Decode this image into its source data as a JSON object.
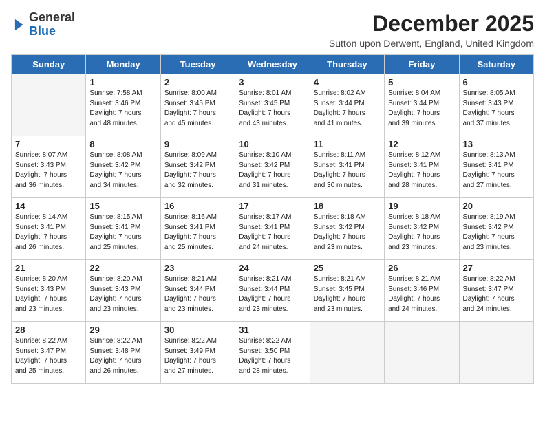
{
  "logo": {
    "general": "General",
    "blue": "Blue"
  },
  "title": "December 2025",
  "subtitle": "Sutton upon Derwent, England, United Kingdom",
  "days_header": [
    "Sunday",
    "Monday",
    "Tuesday",
    "Wednesday",
    "Thursday",
    "Friday",
    "Saturday"
  ],
  "weeks": [
    [
      {
        "day": "",
        "info": ""
      },
      {
        "day": "1",
        "info": "Sunrise: 7:58 AM\nSunset: 3:46 PM\nDaylight: 7 hours\nand 48 minutes."
      },
      {
        "day": "2",
        "info": "Sunrise: 8:00 AM\nSunset: 3:45 PM\nDaylight: 7 hours\nand 45 minutes."
      },
      {
        "day": "3",
        "info": "Sunrise: 8:01 AM\nSunset: 3:45 PM\nDaylight: 7 hours\nand 43 minutes."
      },
      {
        "day": "4",
        "info": "Sunrise: 8:02 AM\nSunset: 3:44 PM\nDaylight: 7 hours\nand 41 minutes."
      },
      {
        "day": "5",
        "info": "Sunrise: 8:04 AM\nSunset: 3:44 PM\nDaylight: 7 hours\nand 39 minutes."
      },
      {
        "day": "6",
        "info": "Sunrise: 8:05 AM\nSunset: 3:43 PM\nDaylight: 7 hours\nand 37 minutes."
      }
    ],
    [
      {
        "day": "7",
        "info": "Sunrise: 8:07 AM\nSunset: 3:43 PM\nDaylight: 7 hours\nand 36 minutes."
      },
      {
        "day": "8",
        "info": "Sunrise: 8:08 AM\nSunset: 3:42 PM\nDaylight: 7 hours\nand 34 minutes."
      },
      {
        "day": "9",
        "info": "Sunrise: 8:09 AM\nSunset: 3:42 PM\nDaylight: 7 hours\nand 32 minutes."
      },
      {
        "day": "10",
        "info": "Sunrise: 8:10 AM\nSunset: 3:42 PM\nDaylight: 7 hours\nand 31 minutes."
      },
      {
        "day": "11",
        "info": "Sunrise: 8:11 AM\nSunset: 3:41 PM\nDaylight: 7 hours\nand 30 minutes."
      },
      {
        "day": "12",
        "info": "Sunrise: 8:12 AM\nSunset: 3:41 PM\nDaylight: 7 hours\nand 28 minutes."
      },
      {
        "day": "13",
        "info": "Sunrise: 8:13 AM\nSunset: 3:41 PM\nDaylight: 7 hours\nand 27 minutes."
      }
    ],
    [
      {
        "day": "14",
        "info": "Sunrise: 8:14 AM\nSunset: 3:41 PM\nDaylight: 7 hours\nand 26 minutes."
      },
      {
        "day": "15",
        "info": "Sunrise: 8:15 AM\nSunset: 3:41 PM\nDaylight: 7 hours\nand 25 minutes."
      },
      {
        "day": "16",
        "info": "Sunrise: 8:16 AM\nSunset: 3:41 PM\nDaylight: 7 hours\nand 25 minutes."
      },
      {
        "day": "17",
        "info": "Sunrise: 8:17 AM\nSunset: 3:41 PM\nDaylight: 7 hours\nand 24 minutes."
      },
      {
        "day": "18",
        "info": "Sunrise: 8:18 AM\nSunset: 3:42 PM\nDaylight: 7 hours\nand 23 minutes."
      },
      {
        "day": "19",
        "info": "Sunrise: 8:18 AM\nSunset: 3:42 PM\nDaylight: 7 hours\nand 23 minutes."
      },
      {
        "day": "20",
        "info": "Sunrise: 8:19 AM\nSunset: 3:42 PM\nDaylight: 7 hours\nand 23 minutes."
      }
    ],
    [
      {
        "day": "21",
        "info": "Sunrise: 8:20 AM\nSunset: 3:43 PM\nDaylight: 7 hours\nand 23 minutes."
      },
      {
        "day": "22",
        "info": "Sunrise: 8:20 AM\nSunset: 3:43 PM\nDaylight: 7 hours\nand 23 minutes."
      },
      {
        "day": "23",
        "info": "Sunrise: 8:21 AM\nSunset: 3:44 PM\nDaylight: 7 hours\nand 23 minutes."
      },
      {
        "day": "24",
        "info": "Sunrise: 8:21 AM\nSunset: 3:44 PM\nDaylight: 7 hours\nand 23 minutes."
      },
      {
        "day": "25",
        "info": "Sunrise: 8:21 AM\nSunset: 3:45 PM\nDaylight: 7 hours\nand 23 minutes."
      },
      {
        "day": "26",
        "info": "Sunrise: 8:21 AM\nSunset: 3:46 PM\nDaylight: 7 hours\nand 24 minutes."
      },
      {
        "day": "27",
        "info": "Sunrise: 8:22 AM\nSunset: 3:47 PM\nDaylight: 7 hours\nand 24 minutes."
      }
    ],
    [
      {
        "day": "28",
        "info": "Sunrise: 8:22 AM\nSunset: 3:47 PM\nDaylight: 7 hours\nand 25 minutes."
      },
      {
        "day": "29",
        "info": "Sunrise: 8:22 AM\nSunset: 3:48 PM\nDaylight: 7 hours\nand 26 minutes."
      },
      {
        "day": "30",
        "info": "Sunrise: 8:22 AM\nSunset: 3:49 PM\nDaylight: 7 hours\nand 27 minutes."
      },
      {
        "day": "31",
        "info": "Sunrise: 8:22 AM\nSunset: 3:50 PM\nDaylight: 7 hours\nand 28 minutes."
      },
      {
        "day": "",
        "info": ""
      },
      {
        "day": "",
        "info": ""
      },
      {
        "day": "",
        "info": ""
      }
    ]
  ]
}
